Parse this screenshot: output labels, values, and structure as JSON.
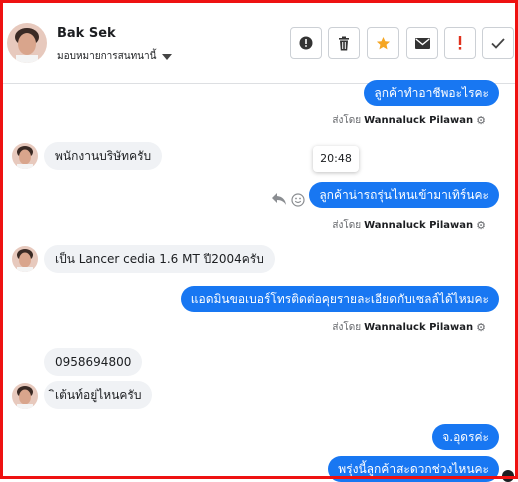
{
  "header": {
    "contact_name": "Bak Sek",
    "assign_label": "มอบหมายการสนทนานี้",
    "buttons": [
      {
        "name": "spam-button",
        "icon": "exclamation-circle-icon"
      },
      {
        "name": "delete-button",
        "icon": "trash-icon"
      },
      {
        "name": "star-button",
        "icon": "star-icon",
        "color": "#f5a623"
      },
      {
        "name": "email-button",
        "icon": "envelope-icon"
      },
      {
        "name": "follow-up-button",
        "icon": "exclamation-icon",
        "color": "#e0311d"
      },
      {
        "name": "done-button",
        "icon": "check-icon"
      }
    ]
  },
  "messages": {
    "m1": {
      "text": "ลูกค้าทำอาชีพอะไรคะ",
      "direction": "out"
    },
    "m1_sentby_prefix": "ส่งโดย",
    "m1_sentby_name": "Wannaluck Pilawan",
    "m2": {
      "text": "พนักงานบริษัทครับ",
      "direction": "in"
    },
    "tooltip_time": "20:48",
    "m3": {
      "text": "ลูกค้าน่ารถรุ่นไหนเข้ามาเทิร์นคะ",
      "direction": "out"
    },
    "m3_sentby_prefix": "ส่งโดย",
    "m3_sentby_name": "Wannaluck Pilawan",
    "m4": {
      "text": "เป็น Lancer cedia 1.6 MT ปี2004ครับ",
      "direction": "in"
    },
    "m5": {
      "text": "แอดมินขอเบอร์โทรติดต่อคุยรายละเอียดกับเซลล์ได้ไหมคะ",
      "direction": "out"
    },
    "m5_sentby_prefix": "ส่งโดย",
    "m5_sentby_name": "Wannaluck Pilawan",
    "m6": {
      "text": "0958694800",
      "direction": "in"
    },
    "m7": {
      "text": "ิเต้นท์อยู่ไหนครับ",
      "direction": "in"
    },
    "m8": {
      "text": "จ.อุดรค่ะ",
      "direction": "out"
    },
    "m9": {
      "text": "พรุ่งนี้ลูกค้าสะดวกช่วงไหนคะ",
      "direction": "out"
    }
  },
  "colors": {
    "accent": "#1877f2",
    "incoming_bubble": "#f0f2f5",
    "frame": "#ee1111"
  }
}
